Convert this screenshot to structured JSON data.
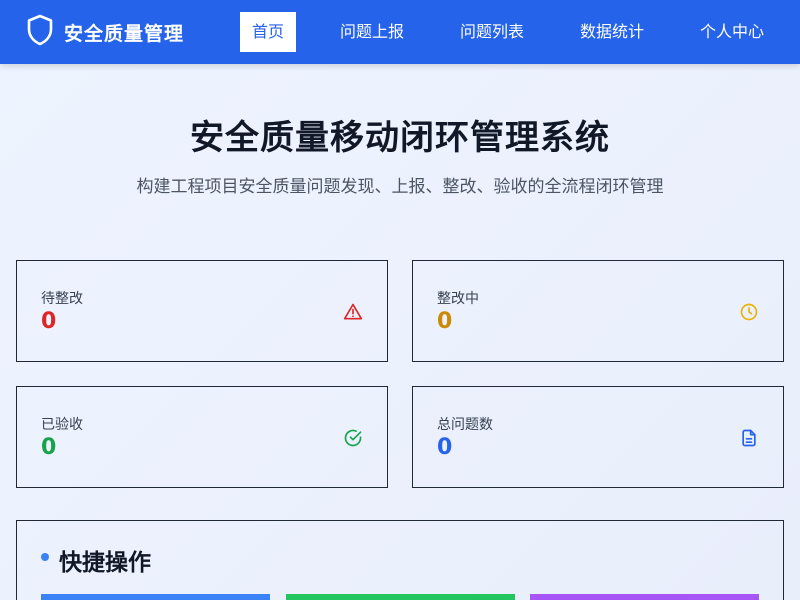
{
  "header": {
    "brand": "安全质量管理",
    "brand_icon": "shield-icon",
    "nav": [
      {
        "label": "首页",
        "active": true
      },
      {
        "label": "问题上报",
        "active": false
      },
      {
        "label": "问题列表",
        "active": false
      },
      {
        "label": "数据统计",
        "active": false
      },
      {
        "label": "个人中心",
        "active": false
      }
    ]
  },
  "hero": {
    "title": "安全质量移动闭环管理系统",
    "subtitle": "构建工程项目安全质量问题发现、上报、整改、验收的全流程闭环管理"
  },
  "stats": [
    {
      "label": "待整改",
      "value": "0",
      "color": "#dc2626",
      "icon": "alert-triangle-icon"
    },
    {
      "label": "整改中",
      "value": "0",
      "color": "#ca8a04",
      "icon": "clock-icon"
    },
    {
      "label": "已验收",
      "value": "0",
      "color": "#16a34a",
      "icon": "check-circle-icon"
    },
    {
      "label": "总问题数",
      "value": "0",
      "color": "#2563eb",
      "icon": "document-icon"
    }
  ],
  "quick": {
    "title": "快捷操作",
    "buttons": [
      {
        "color": "#3b82f6"
      },
      {
        "color": "#22c55e"
      },
      {
        "color": "#a855f7"
      }
    ]
  }
}
